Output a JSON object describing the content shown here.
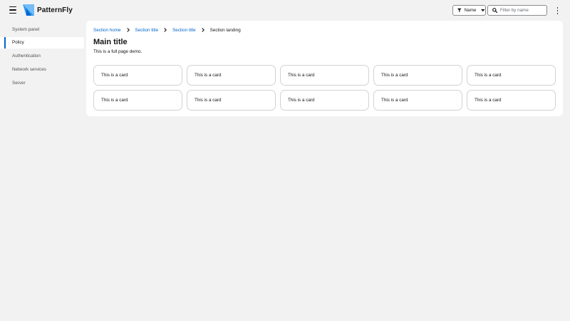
{
  "masthead": {
    "brand_name": "PatternFly",
    "filter": {
      "label": "Name"
    },
    "search": {
      "placeholder": "Filter by name"
    },
    "colors": {
      "logo_light": "#73bcf7",
      "logo_mid": "#2b9af3",
      "logo_dark": "#0066cc"
    }
  },
  "sidebar": {
    "items": [
      {
        "label": "System panel",
        "active": false
      },
      {
        "label": "Policy",
        "active": true
      },
      {
        "label": "Authentication",
        "active": false
      },
      {
        "label": "Network services",
        "active": false
      },
      {
        "label": "Server",
        "active": false
      }
    ],
    "accent_color": "#0066cc"
  },
  "main": {
    "breadcrumb": [
      {
        "label": "Section home",
        "link": true
      },
      {
        "label": "Section title",
        "link": true
      },
      {
        "label": "Section title",
        "link": true
      },
      {
        "label": "Section landing",
        "link": false
      }
    ],
    "title": "Main title",
    "description": "This is a full page demo.",
    "cards": [
      "This is a card",
      "This is a card",
      "This is a card",
      "This is a card",
      "This is a card",
      "This is a card",
      "This is a card",
      "This is a card",
      "This is a card",
      "This is a card"
    ]
  }
}
